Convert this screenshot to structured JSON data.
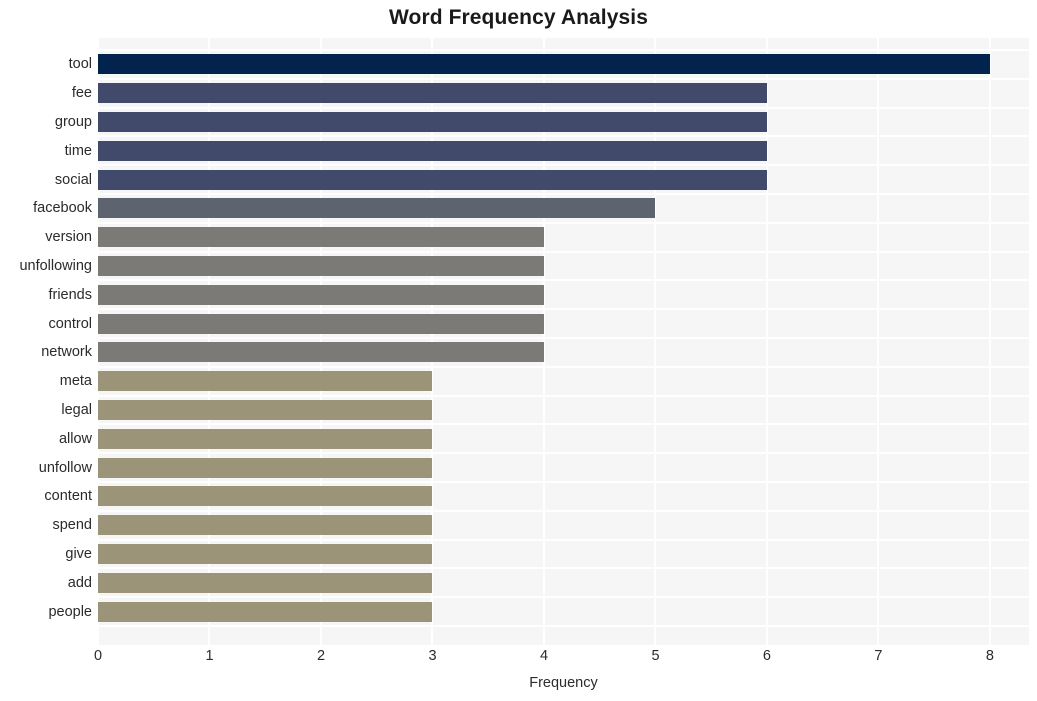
{
  "chart_data": {
    "type": "bar",
    "orientation": "horizontal",
    "title": "Word Frequency Analysis",
    "xlabel": "Frequency",
    "ylabel": "",
    "categories": [
      "tool",
      "fee",
      "group",
      "time",
      "social",
      "facebook",
      "version",
      "unfollowing",
      "friends",
      "control",
      "network",
      "meta",
      "legal",
      "allow",
      "unfollow",
      "content",
      "spend",
      "give",
      "add",
      "people"
    ],
    "values": [
      8,
      6,
      6,
      6,
      6,
      5,
      4,
      4,
      4,
      4,
      4,
      3,
      3,
      3,
      3,
      3,
      3,
      3,
      3,
      3
    ],
    "xlim": [
      0,
      8.35
    ],
    "xticks": [
      0,
      1,
      2,
      3,
      4,
      5,
      6,
      7,
      8
    ],
    "xticklabels": [
      "0",
      "1",
      "2",
      "3",
      "4",
      "5",
      "6",
      "7",
      "8"
    ],
    "grid": true,
    "legend": false,
    "bar_colors": [
      "#03234f",
      "#414a6b",
      "#414a6b",
      "#414a6b",
      "#414a6b",
      "#5e6370",
      "#7b7a77",
      "#7b7a77",
      "#7b7a77",
      "#7b7a77",
      "#7b7a77",
      "#9b9478",
      "#9b9478",
      "#9b9478",
      "#9b9478",
      "#9b9478",
      "#9b9478",
      "#9b9478",
      "#9b9478",
      "#9b9478"
    ],
    "plot_background": "#f6f6f6",
    "gridline_color": "#ffffff",
    "figure_background": "#ffffff"
  }
}
